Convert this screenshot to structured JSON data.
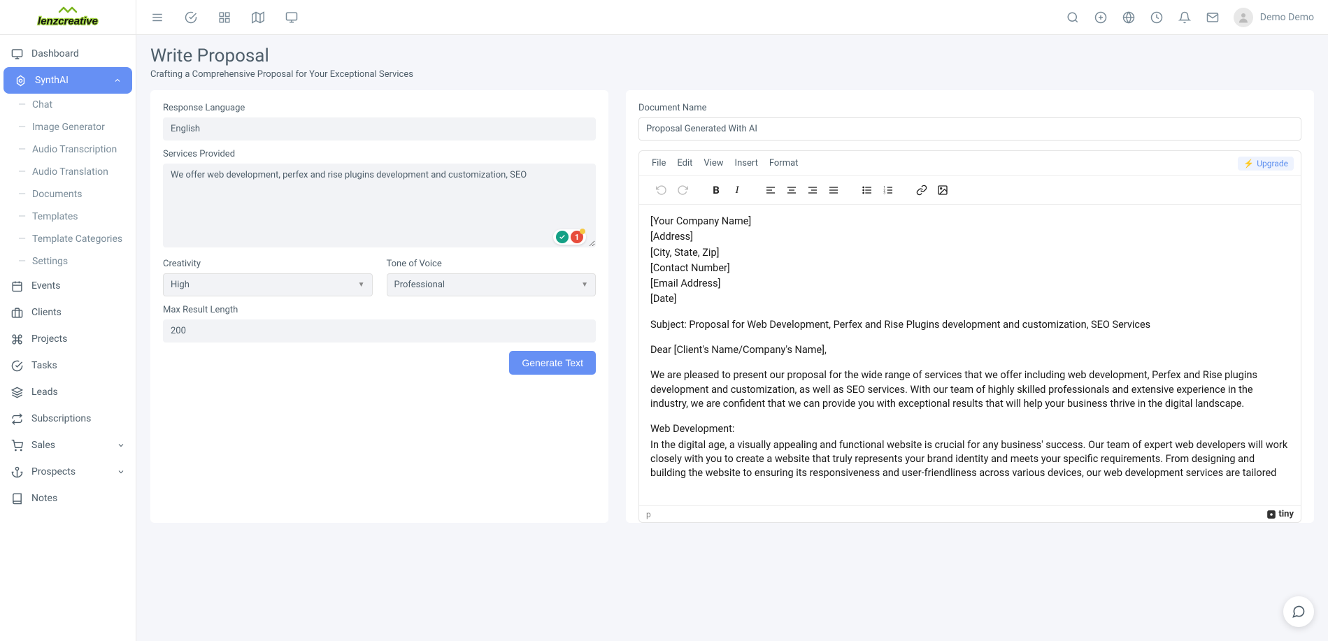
{
  "brand": "lenzcreative",
  "user": {
    "name": "Demo Demo"
  },
  "topbar": {},
  "sidebar": {
    "items": [
      {
        "label": "Dashboard",
        "icon": "monitor"
      },
      {
        "label": "SynthAI",
        "icon": "ai",
        "active": true,
        "expanded": true
      },
      {
        "label": "Events",
        "icon": "calendar"
      },
      {
        "label": "Clients",
        "icon": "briefcase"
      },
      {
        "label": "Projects",
        "icon": "command"
      },
      {
        "label": "Tasks",
        "icon": "check-circle"
      },
      {
        "label": "Leads",
        "icon": "layers"
      },
      {
        "label": "Subscriptions",
        "icon": "repeat"
      },
      {
        "label": "Sales",
        "icon": "cart",
        "chevron": true
      },
      {
        "label": "Prospects",
        "icon": "anchor",
        "chevron": true
      },
      {
        "label": "Notes",
        "icon": "book"
      }
    ],
    "subitems": [
      {
        "label": "Chat"
      },
      {
        "label": "Image Generator"
      },
      {
        "label": "Audio Transcription"
      },
      {
        "label": "Audio Translation"
      },
      {
        "label": "Documents"
      },
      {
        "label": "Templates"
      },
      {
        "label": "Template Categories"
      },
      {
        "label": "Settings"
      }
    ]
  },
  "page": {
    "title": "Write Proposal",
    "subtitle": "Crafting a Comprehensive Proposal for Your Exceptional Services"
  },
  "form": {
    "responseLanguage": {
      "label": "Response Language",
      "value": "English"
    },
    "servicesProvided": {
      "label": "Services Provided",
      "value": "We offer web development, perfex and rise plugins development and customization, SEO"
    },
    "creativity": {
      "label": "Creativity",
      "value": "High"
    },
    "tone": {
      "label": "Tone of Voice",
      "value": "Professional"
    },
    "maxLength": {
      "label": "Max Result Length",
      "value": "200"
    },
    "generate": "Generate Text",
    "badgeGreen": "●",
    "badgeRedCount": "1"
  },
  "doc": {
    "nameLabel": "Document Name",
    "name": "Proposal Generated With AI",
    "menus": [
      "File",
      "Edit",
      "View",
      "Insert",
      "Format"
    ],
    "upgrade": "Upgrade",
    "statusPath": "p",
    "tiny": "tiny",
    "body": {
      "l1": "[Your Company Name]",
      "l2": "[Address]",
      "l3": "[City, State, Zip]",
      "l4": "[Contact Number]",
      "l5": "[Email Address]",
      "l6": "[Date]",
      "subject": "Subject: Proposal for Web Development, Perfex and Rise Plugins development and customization, SEO Services",
      "greeting": "Dear [Client's Name/Company's Name],",
      "p1": "We are pleased to present our proposal for the wide range of services that we offer including web development, Perfex and Rise plugins development and customization, as well as SEO services. With our team of highly skilled professionals and extensive experience in the industry, we are confident that we can provide you with exceptional results that will help your business thrive in the digital landscape.",
      "h1": "Web Development:",
      "p2": "In the digital age, a visually appealing and functional website is crucial for any business' success. Our team of expert web developers will work closely with you to create a website that truly represents your brand identity and meets your specific requirements. From designing and building the website to ensuring its responsiveness and user-friendliness across various devices, our web development services are tailored"
    }
  }
}
